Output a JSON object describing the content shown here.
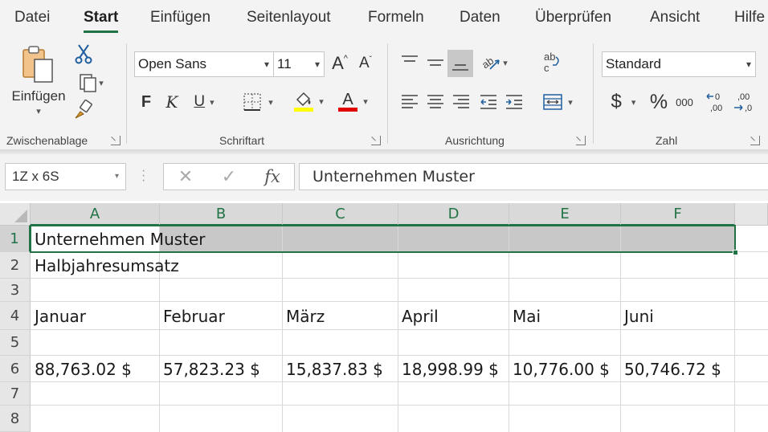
{
  "ribbon_tabs": [
    "Datei",
    "Start",
    "Einfügen",
    "Seitenlayout",
    "Formeln",
    "Daten",
    "Überprüfen",
    "Ansicht",
    "Hilfe"
  ],
  "active_tab": "Start",
  "clipboard": {
    "paste_label": "Einfügen",
    "group_label": "Zwischenablage"
  },
  "font": {
    "family": "Open Sans",
    "size": "11",
    "bold": "F",
    "italic": "K",
    "underline": "U",
    "grow": "A",
    "shrink": "A",
    "highlight_color": "#ffff00",
    "font_color": "#e00000",
    "group_label": "Schriftart"
  },
  "alignment": {
    "group_label": "Ausrichtung",
    "wrap_text": "ab c"
  },
  "number": {
    "format": "Standard",
    "currency": "$",
    "percent": "%",
    "thousands": "000",
    "group_label": "Zahl"
  },
  "formula_bar": {
    "name_box": "1Z x 6S",
    "fx": "fx",
    "content": "Unternehmen Muster"
  },
  "columns": [
    "A",
    "B",
    "C",
    "D",
    "E",
    "F"
  ],
  "rows": [
    "1",
    "2",
    "3",
    "4",
    "5",
    "6",
    "7",
    "8"
  ],
  "cells": {
    "A1": "Unternehmen Muster",
    "A2": "Halbjahresumsatz",
    "A4": "Januar",
    "B4": "Februar",
    "C4": "März",
    "D4": "April",
    "E4": "Mai",
    "F4": "Juni",
    "A6": "88,763.02 $",
    "B6": "57,823.23 $",
    "C6": "15,837.83 $",
    "D6": "18,998.99 $",
    "E6": "10,776.00 $",
    "F6": "50,746.72 $"
  },
  "accent_color": "#217346"
}
